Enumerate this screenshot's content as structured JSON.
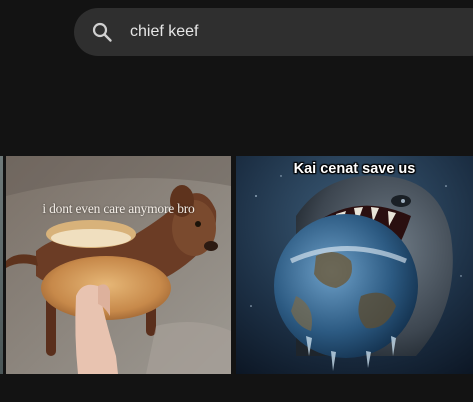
{
  "search": {
    "query": "chief keef",
    "icon": "search-icon"
  },
  "results": [
    {
      "caption": "i dont even care anymore bro",
      "subject": "dog in a hot dog bun"
    },
    {
      "caption": "Kai cenat save us",
      "subject": "monster devouring the earth"
    }
  ],
  "colors": {
    "page_background": "#131313",
    "search_background": "#2f2f2f",
    "search_text": "#e6e6e6"
  }
}
